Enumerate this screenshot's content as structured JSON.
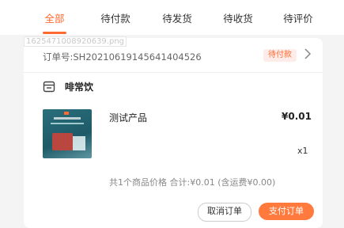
{
  "tabs": [
    {
      "label": "全部",
      "active": true
    },
    {
      "label": "待付款",
      "active": false
    },
    {
      "label": "待发货",
      "active": false
    },
    {
      "label": "待收货",
      "active": false
    },
    {
      "label": "待评价",
      "active": false
    }
  ],
  "overlay_filename": "1625471008920639.png",
  "order": {
    "number_label": "订单号:SH20210619145641404526",
    "status": "待付款",
    "shop_name": "啡常饮",
    "product": {
      "name": "测试产品",
      "price": "¥0.01",
      "quantity": "x1"
    },
    "summary": "共1个商品价格  合计:¥0.01  (含运费¥0.00)",
    "cancel_label": "取消订单",
    "pay_label": "支付订单"
  },
  "colors": {
    "accent": "#ff6a30",
    "pay_button": "#ff7a3c",
    "badge_bg": "#fdecea"
  }
}
